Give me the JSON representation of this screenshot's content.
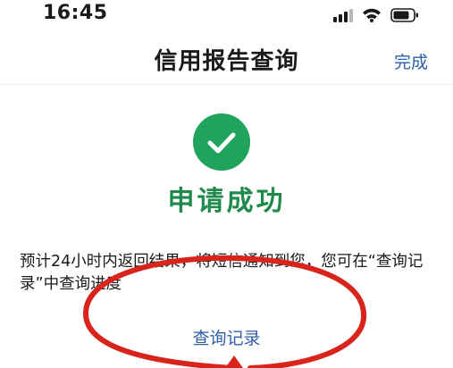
{
  "status_bar": {
    "time": "16:45",
    "icons": [
      "signal-icon",
      "wifi-icon",
      "battery-icon"
    ]
  },
  "nav": {
    "title": "信用报告查询",
    "done_label": "完成"
  },
  "result": {
    "icon": "checkmark-icon",
    "title": "申请成功",
    "description": "预计24小时内返回结果，将短信通知到您，您可在“查询记录”中查询进度",
    "link_label": "查询记录"
  },
  "colors": {
    "success_green": "#20a35a",
    "title_green": "#1f8a4c",
    "link_blue": "#2f5fa8",
    "annotation_red": "#d9241b"
  }
}
